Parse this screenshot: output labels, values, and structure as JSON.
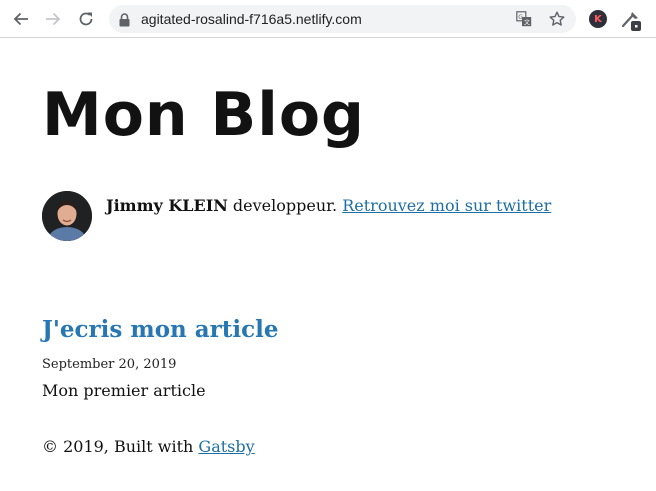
{
  "browser": {
    "url": "agitated-rosalind-f716a5.netlify.com",
    "profile_initial": "K",
    "icons": [
      "back-arrow-icon",
      "forward-arrow-icon",
      "reload-icon",
      "lock-icon",
      "translate-icon",
      "star-icon",
      "extension-icon"
    ]
  },
  "blog": {
    "title": "Mon Blog",
    "author_name": "Jimmy KLEIN",
    "author_desc": " developpeur. ",
    "twitter_link": "Retrouvez moi sur twitter"
  },
  "posts": [
    {
      "title": "J'ecris mon article",
      "date": "September 20, 2019",
      "excerpt": "Mon premier article"
    }
  ],
  "footer": {
    "text": "© 2019, Built with ",
    "link": "Gatsby"
  },
  "colors": {
    "link": "#1c6ea4",
    "post_title": "#2677b3",
    "text": "#111111"
  }
}
